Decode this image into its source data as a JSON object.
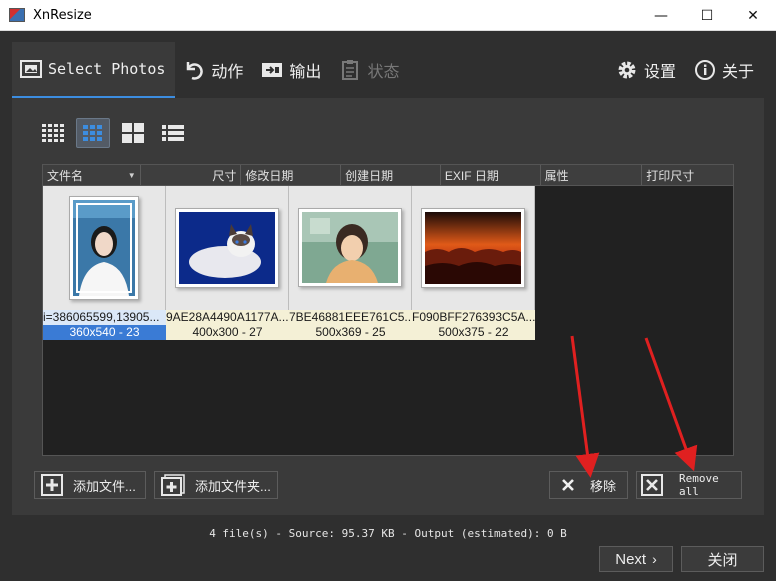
{
  "window": {
    "title": "XnResize",
    "minimize": "—",
    "maximize": "☐",
    "close": "✕"
  },
  "tabs": [
    {
      "label": "Select Photos",
      "icon": "select-photos-icon",
      "state": "active"
    },
    {
      "label": "动作",
      "icon": "action-icon",
      "state": "normal"
    },
    {
      "label": "输出",
      "icon": "output-icon",
      "state": "normal"
    },
    {
      "label": "状态",
      "icon": "status-icon",
      "state": "disabled"
    },
    {
      "label": "设置",
      "icon": "gear-icon",
      "state": "normal"
    },
    {
      "label": "关于",
      "icon": "info-icon",
      "state": "normal"
    }
  ],
  "view_modes": [
    "small-grid-icon",
    "medium-grid-icon",
    "large-grid-icon",
    "list-view-icon"
  ],
  "columns": [
    "文件名",
    "尺寸",
    "修改日期",
    "创建日期",
    "EXIF 日期",
    "属性",
    "打印尺寸"
  ],
  "files": [
    {
      "name": "i=386065599,13905...",
      "info": "360x540 - 23",
      "selected": true
    },
    {
      "name": "9AE28A4490A1177A...",
      "info": "400x300 - 27",
      "selected": false
    },
    {
      "name": "7BE46881EEE761C5...",
      "info": "500x369 - 25",
      "selected": false
    },
    {
      "name": "F090BFF276393C5A...",
      "info": "500x375 - 22",
      "selected": false
    }
  ],
  "buttons": {
    "add_files": "添加文件...",
    "add_folder": "添加文件夹...",
    "remove": "移除",
    "remove_all": "Remove all",
    "next": "Next",
    "close": "关闭"
  },
  "status": "4 file(s) - Source: 95.37 KB - Output (estimated): 0 B",
  "colors": {
    "accent": "#3c8de0",
    "background": "#2f2f2f",
    "panel": "#3a3a3a",
    "arrow": "#e02020"
  }
}
